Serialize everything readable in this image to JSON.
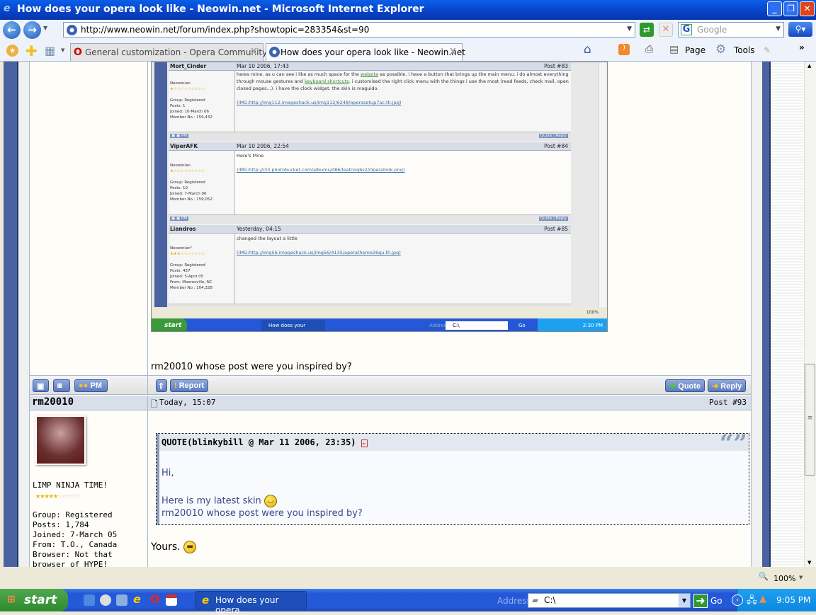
{
  "window": {
    "title": "How does your opera look like - Neowin.net - Microsoft Internet Explorer"
  },
  "browser": {
    "url": "http://www.neowin.net/forum/index.php?showtopic=283354&st=90",
    "search_placeholder": "Google",
    "tabs": [
      {
        "label": "General customization - Opera Community",
        "active": false
      },
      {
        "label": "How does your opera look like - Neowin.net",
        "active": true
      }
    ],
    "commands": {
      "page": "Page",
      "tools": "Tools",
      "more": "»"
    },
    "zoom": "100%"
  },
  "embedded_screenshot": {
    "posts": [
      {
        "author": "Mort_Cinder",
        "date": "Mar 10 2006, 17:43",
        "post_no": "Post #83",
        "rank": "Neowinian",
        "group": "Group: Registered",
        "posts": "Posts: 1",
        "joined": "Joined: 10-March 06",
        "member_no": "Member No.: 159,432",
        "text_1": "heres mine. as u can see i like as much space for the ",
        "link_1": "website",
        "text_2": " as possible. i have a button that brings up the main menu. i do almost everything through mouse gestures and ",
        "link_2": "keyboard shortcuts",
        "text_3": ". i customised the right click menu with the things i use the most (read feeds, check mail, open closed pages...). i have the clock widget. the skin is maguido.",
        "img": "(IMG:http://img112.imageshack.us/img112/6248/operasetup7ac.th.jpg)"
      },
      {
        "author": "ViperAFK",
        "date": "Mar 10 2006, 22:54",
        "post_no": "Post #84",
        "rank": "Neowinian",
        "group": "Group: Registered",
        "posts": "Posts: 10",
        "joined": "Joined: 7-March 06",
        "member_no": "Member No.: 159,052",
        "text": "Here's Mine",
        "img": "(IMG:http://i33.photobucket.com/albums/d86/leatnogbs2/Operalook.png)"
      },
      {
        "author": "Liandros",
        "date": "Yesterday, 04:15",
        "post_no": "Post #85",
        "rank": "Neowinian²",
        "group": "Group: Registered",
        "posts": "Posts: 457",
        "joined": "Joined: 5-April 05",
        "from": "From: Mooresville, NC",
        "member_no": "Member No.: 104,328",
        "text": "changed the layout a little",
        "img": "(IMG:http://img56.imageshack.us/img56/4135/operatheme26qu.th.jpg)"
      }
    ],
    "quote_label": "Quote",
    "reply_label": "Reply",
    "pm_label": "PM",
    "zoom": "100%",
    "start": "start",
    "task": "How does your opera...",
    "address_label": "Address",
    "address": "C:\\",
    "go": "Go",
    "clock": "2:30 PM"
  },
  "prev_post": {
    "text": "rm20010 whose post were you inspired by?"
  },
  "post_buttons": {
    "pm": "PM",
    "report": "Report",
    "quote": "Quote",
    "reply": "Reply"
  },
  "post": {
    "author": "rm20010",
    "date": "Today, 15:07",
    "post_no": "Post #93",
    "title": "LIMP NINJA TIME!",
    "stars_filled": 5,
    "stars_total": 10,
    "group": "Group: Registered",
    "posts": "Posts: 1,784",
    "joined": "Joined: 7-March 05",
    "from": "From: T.O., Canada",
    "browser": "Browser: Not that browser of HYPE!",
    "quote_header": "QUOTE(blinkybill @ Mar 11 2006, 23:35)",
    "quote_lines": [
      "Hi,",
      "Here is my latest skin",
      "rm20010 whose post were you inspired by?"
    ],
    "body": "Yours."
  },
  "status": {
    "zoom": "100%"
  },
  "taskbar": {
    "start": "start",
    "task": "How does your opera...",
    "address_label": "Address",
    "address": "C:\\",
    "go": "Go",
    "clock": "9:05 PM"
  }
}
